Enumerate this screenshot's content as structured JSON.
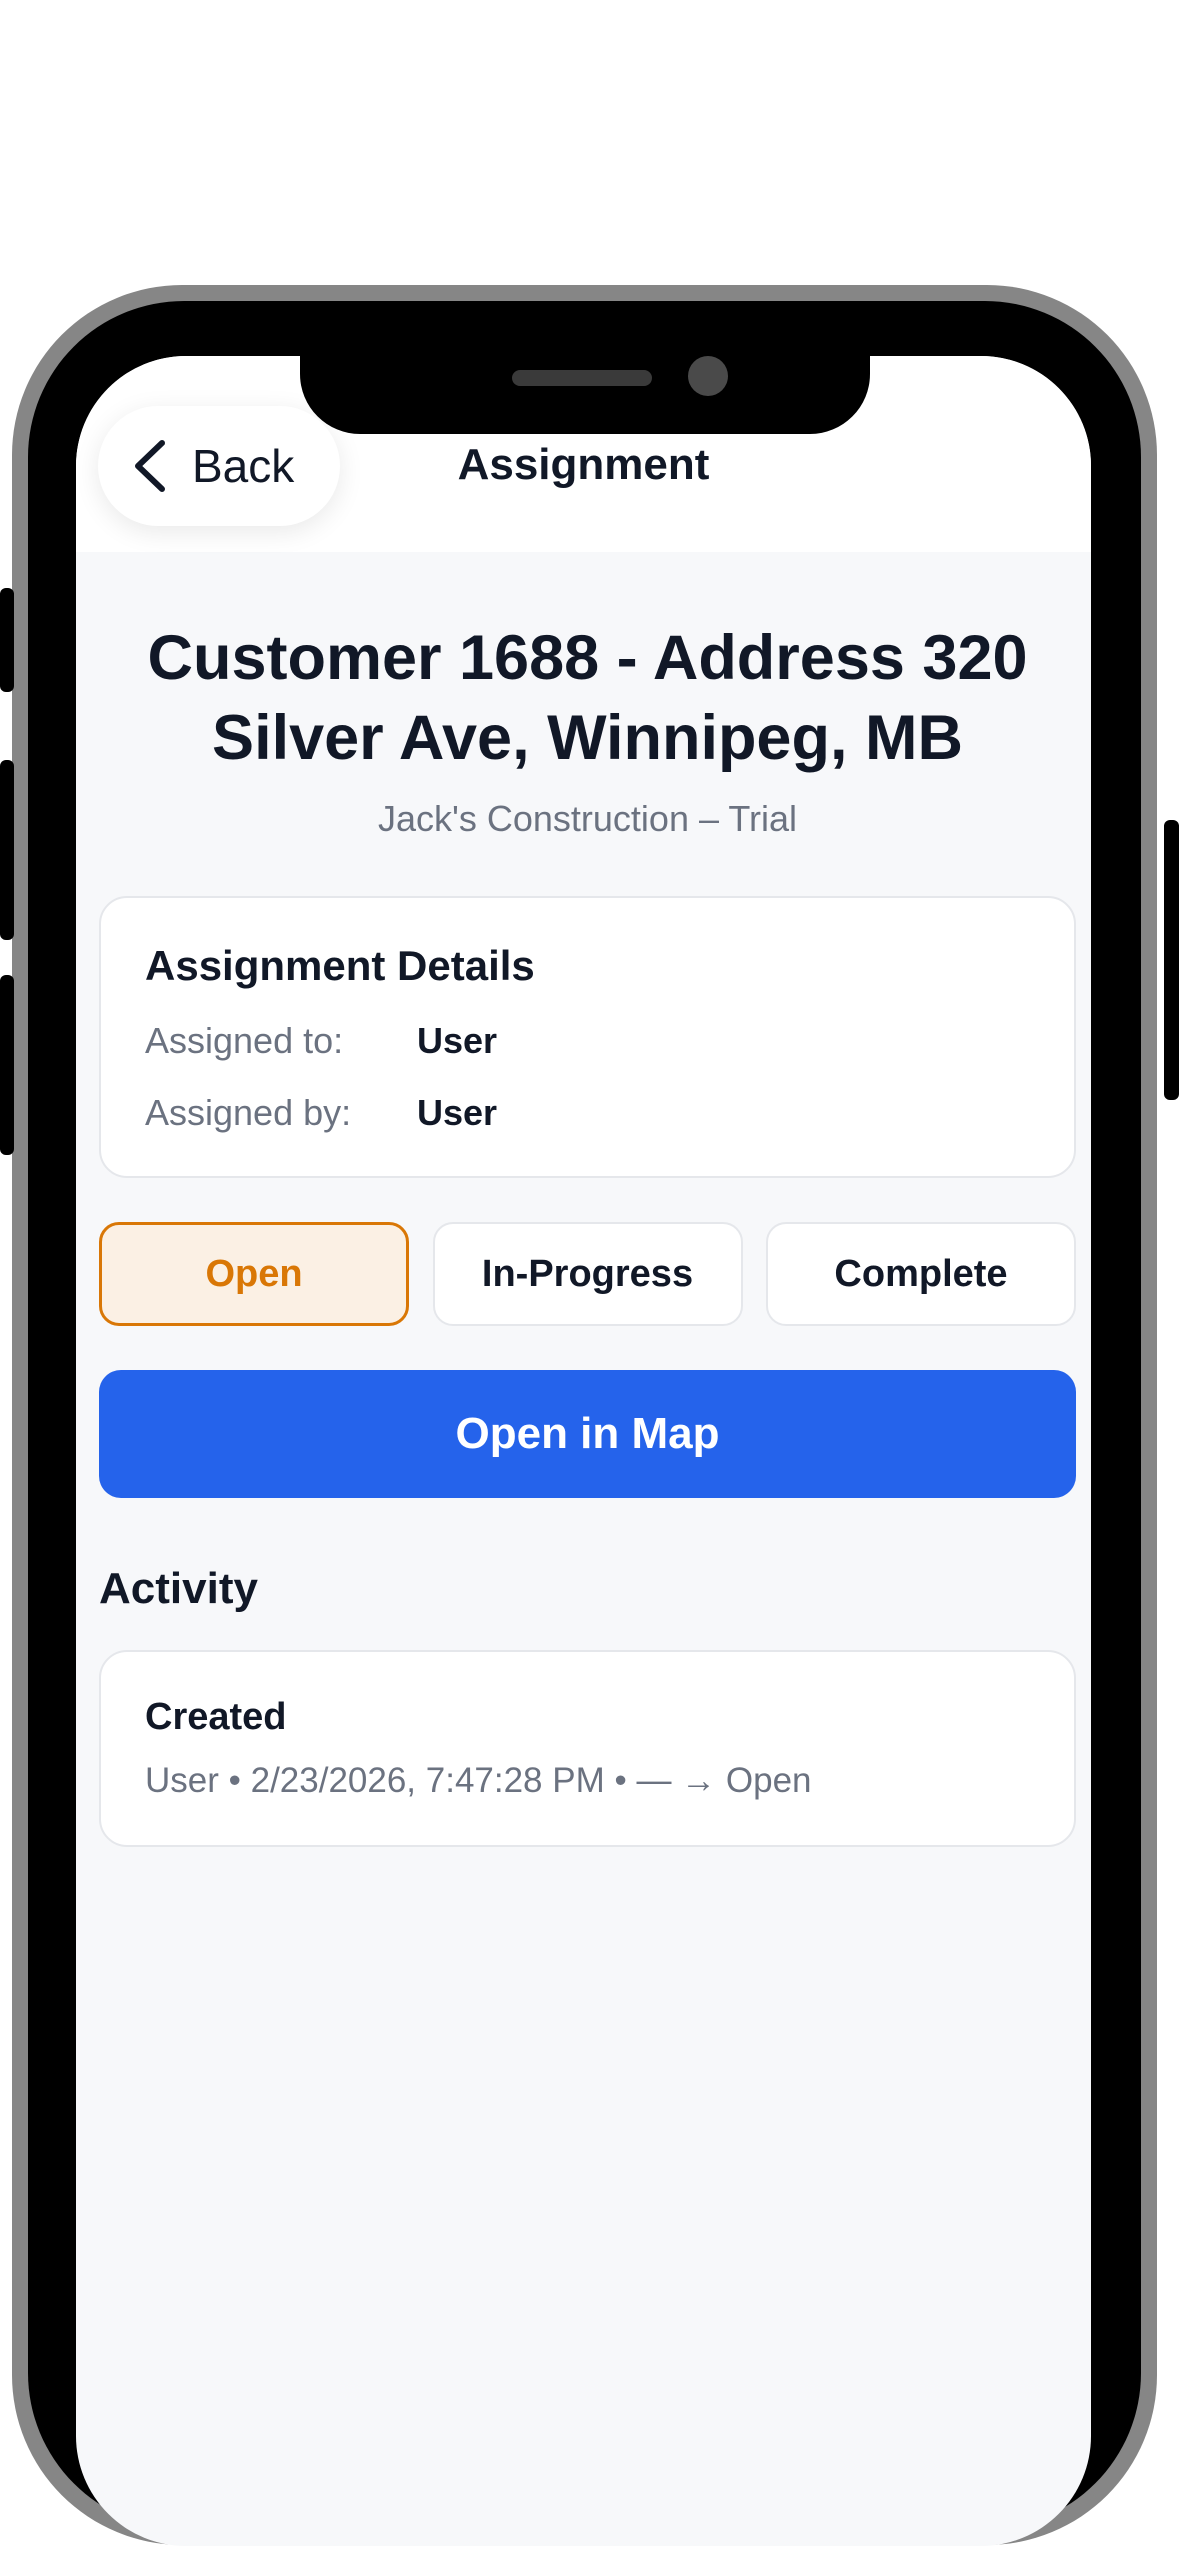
{
  "nav": {
    "back_label": "Back",
    "title": "Assignment"
  },
  "header": {
    "title": "Customer 1688 - Address 320 Silver Ave, Winnipeg, MB",
    "subtitle": "Jack's Construction – Trial"
  },
  "details": {
    "heading": "Assignment Details",
    "rows": [
      {
        "label": "Assigned to:",
        "value": "User"
      },
      {
        "label": "Assigned by:",
        "value": "User"
      }
    ]
  },
  "status": {
    "options": [
      "Open",
      "In-Progress",
      "Complete"
    ],
    "selected": "Open",
    "active_color": "#d97706"
  },
  "map_button": {
    "label": "Open in Map",
    "color": "#2563eb"
  },
  "activity": {
    "heading": "Activity",
    "items": [
      {
        "title": "Created",
        "meta": "User • 2/23/2026, 7:47:28 PM • — → Open"
      }
    ]
  },
  "icons": {
    "back": "chevron-left-icon"
  }
}
